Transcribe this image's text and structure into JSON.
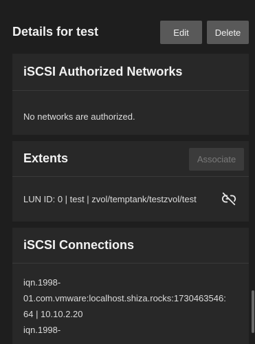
{
  "header": {
    "title": "Details for test",
    "edit_label": "Edit",
    "delete_label": "Delete"
  },
  "authorized_networks": {
    "title": "iSCSI Authorized Networks",
    "empty_text": "No networks are authorized."
  },
  "extents": {
    "title": "Extents",
    "associate_label": "Associate",
    "items": [
      {
        "text": "LUN ID: 0 | test | zvol/temptank/testzvol/test",
        "action_icon": "unlink-icon"
      }
    ]
  },
  "connections": {
    "title": "iSCSI Connections",
    "lines": [
      "iqn.1998-",
      "01.com.vmware:localhost.shiza.rocks:1730463546:",
      "64 | 10.10.2.20",
      "iqn.1998-"
    ]
  },
  "colors": {
    "background": "#1e1e1e",
    "card": "#282828",
    "button": "#595959",
    "button_disabled": "#3b3b3b"
  }
}
